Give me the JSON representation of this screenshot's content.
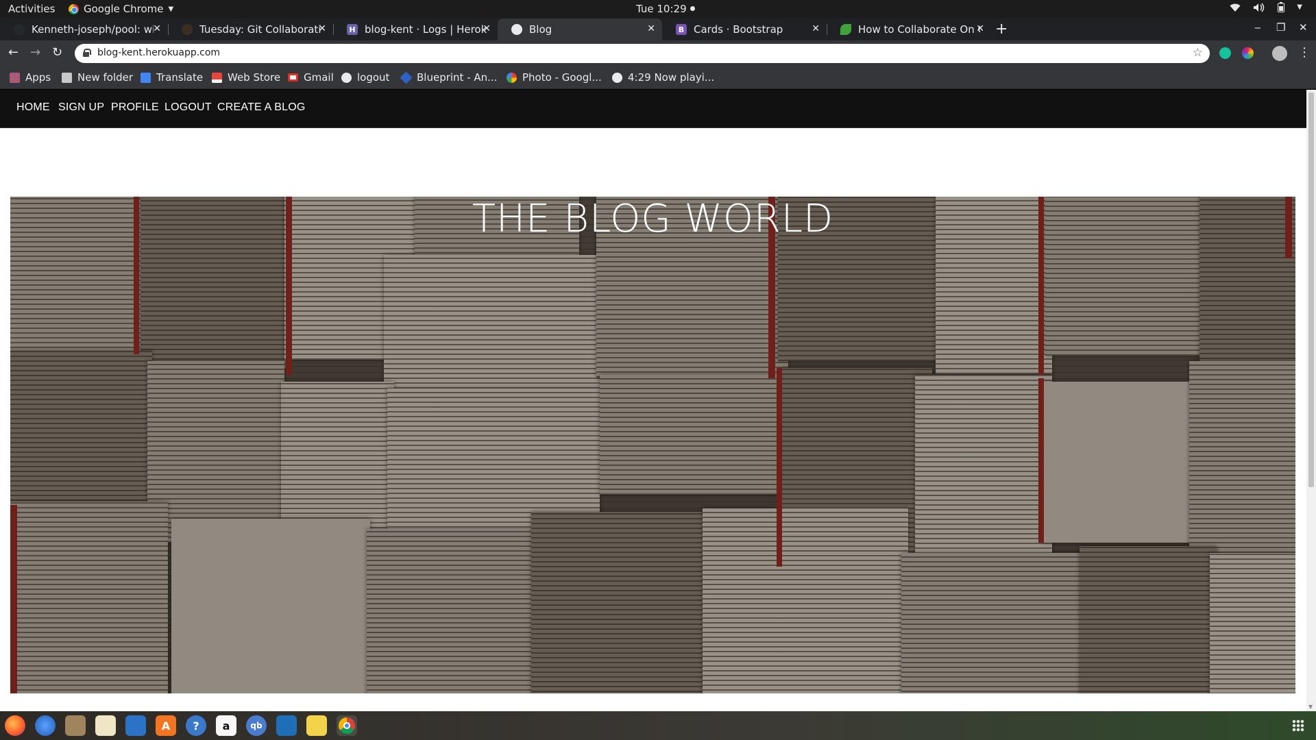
{
  "system_bar": {
    "activities": "Activities",
    "app_name": "Google Chrome",
    "clock": "Tue 10:29"
  },
  "tabs": [
    {
      "title": "Kenneth-joseph/pool: wit",
      "favicon": "github-icon",
      "active": false
    },
    {
      "title": "Tuesday: Git Collaboratio",
      "favicon": "github-icon",
      "active": false
    },
    {
      "title": "blog-kent · Logs | Heroku",
      "favicon": "heroku-icon",
      "active": false
    },
    {
      "title": "Blog",
      "favicon": "globe-icon",
      "active": true
    },
    {
      "title": "Cards · Bootstrap",
      "favicon": "bootstrap-icon",
      "active": false
    },
    {
      "title": "How to Collaborate On Gi",
      "favicon": "leaf-icon",
      "active": false
    }
  ],
  "address_bar": {
    "url": "blog-kent.herokuapp.com"
  },
  "bookmarks": [
    {
      "label": "Apps",
      "icon": "apps-grid-icon"
    },
    {
      "label": "New folder",
      "icon": "folder-icon"
    },
    {
      "label": "Translate",
      "icon": "translate-icon"
    },
    {
      "label": "Web Store",
      "icon": "webstore-icon"
    },
    {
      "label": "Gmail",
      "icon": "gmail-icon"
    },
    {
      "label": "logout",
      "icon": "globe-icon"
    },
    {
      "label": "Blueprint - An...",
      "icon": "blueprint-icon"
    },
    {
      "label": "Photo - Googl...",
      "icon": "photos-icon"
    },
    {
      "label": "4:29 Now playi...",
      "icon": "globe-icon"
    }
  ],
  "site_nav": {
    "home": "HOME",
    "signup": "SIGN UP",
    "profile": "PROFILE",
    "logout": "LOGOUT",
    "create": "CREATE A BLOG"
  },
  "hero": {
    "title": "THE BLOG WORLD"
  },
  "dock": [
    {
      "name": "firefox-icon",
      "glyph": ""
    },
    {
      "name": "thunderbird-icon",
      "glyph": ""
    },
    {
      "name": "files-icon",
      "glyph": ""
    },
    {
      "name": "rhythmbox-icon",
      "glyph": ""
    },
    {
      "name": "writer-icon",
      "glyph": ""
    },
    {
      "name": "software-icon",
      "glyph": "A"
    },
    {
      "name": "help-icon",
      "glyph": "?"
    },
    {
      "name": "amazon-icon",
      "glyph": "a"
    },
    {
      "name": "qbittorrent-icon",
      "glyph": "qb"
    },
    {
      "name": "vscode-icon",
      "glyph": ""
    },
    {
      "name": "notes-icon",
      "glyph": ""
    },
    {
      "name": "chrome-icon",
      "glyph": ""
    }
  ],
  "colors": {
    "tab_bar": "#202124",
    "toolbar": "#35363a",
    "site_nav_bg": "#111111",
    "hero_text": "#ffffff"
  }
}
